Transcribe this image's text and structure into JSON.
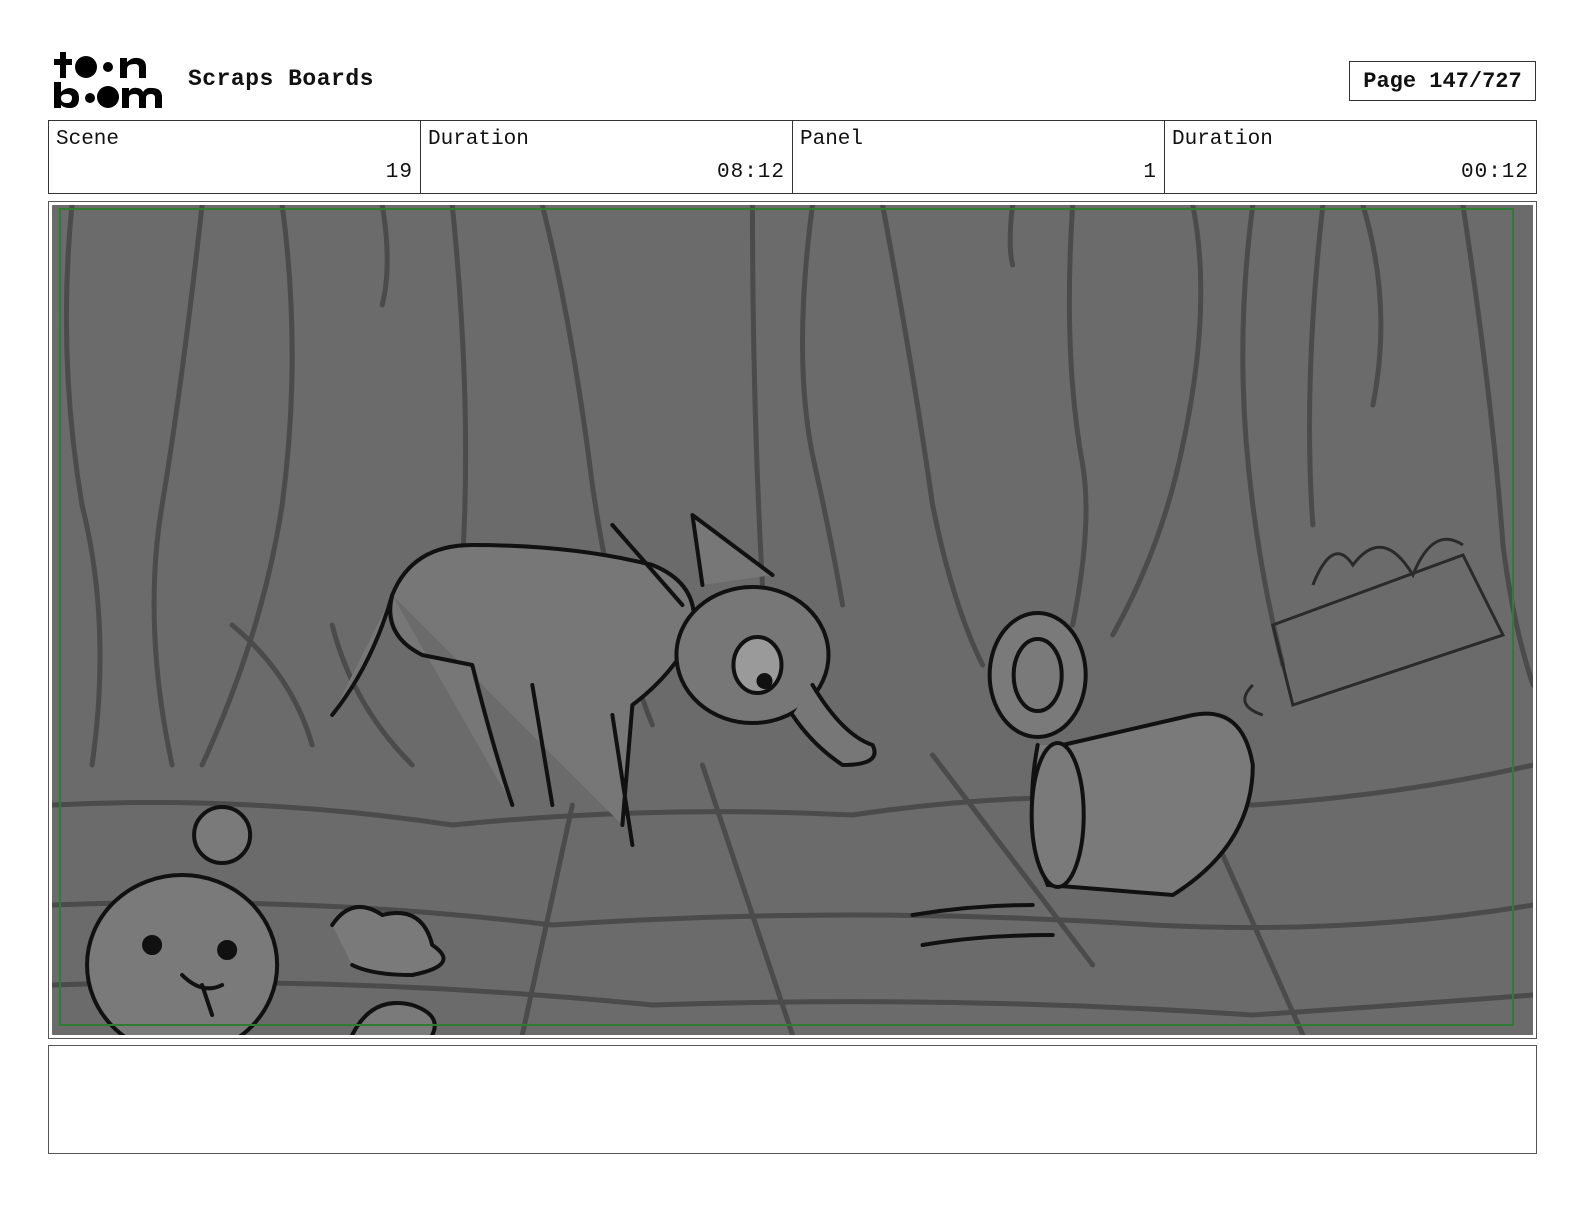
{
  "header": {
    "logo_text": "toon boom",
    "title": "Scraps Boards",
    "page_label": "Page 147/727"
  },
  "info": {
    "scene_label": "Scene",
    "scene_value": "19",
    "scene_duration_label": "Duration",
    "scene_duration_value": "08:12",
    "panel_label": "Panel",
    "panel_value": "1",
    "panel_duration_label": "Duration",
    "panel_duration_value": "00:12"
  },
  "colors": {
    "panel_background": "#6b6b6b",
    "safe_frame": "#2e7d32",
    "sketch_line": "#111111",
    "background_line": "#4a4a4a"
  },
  "notes": {
    "text": ""
  }
}
